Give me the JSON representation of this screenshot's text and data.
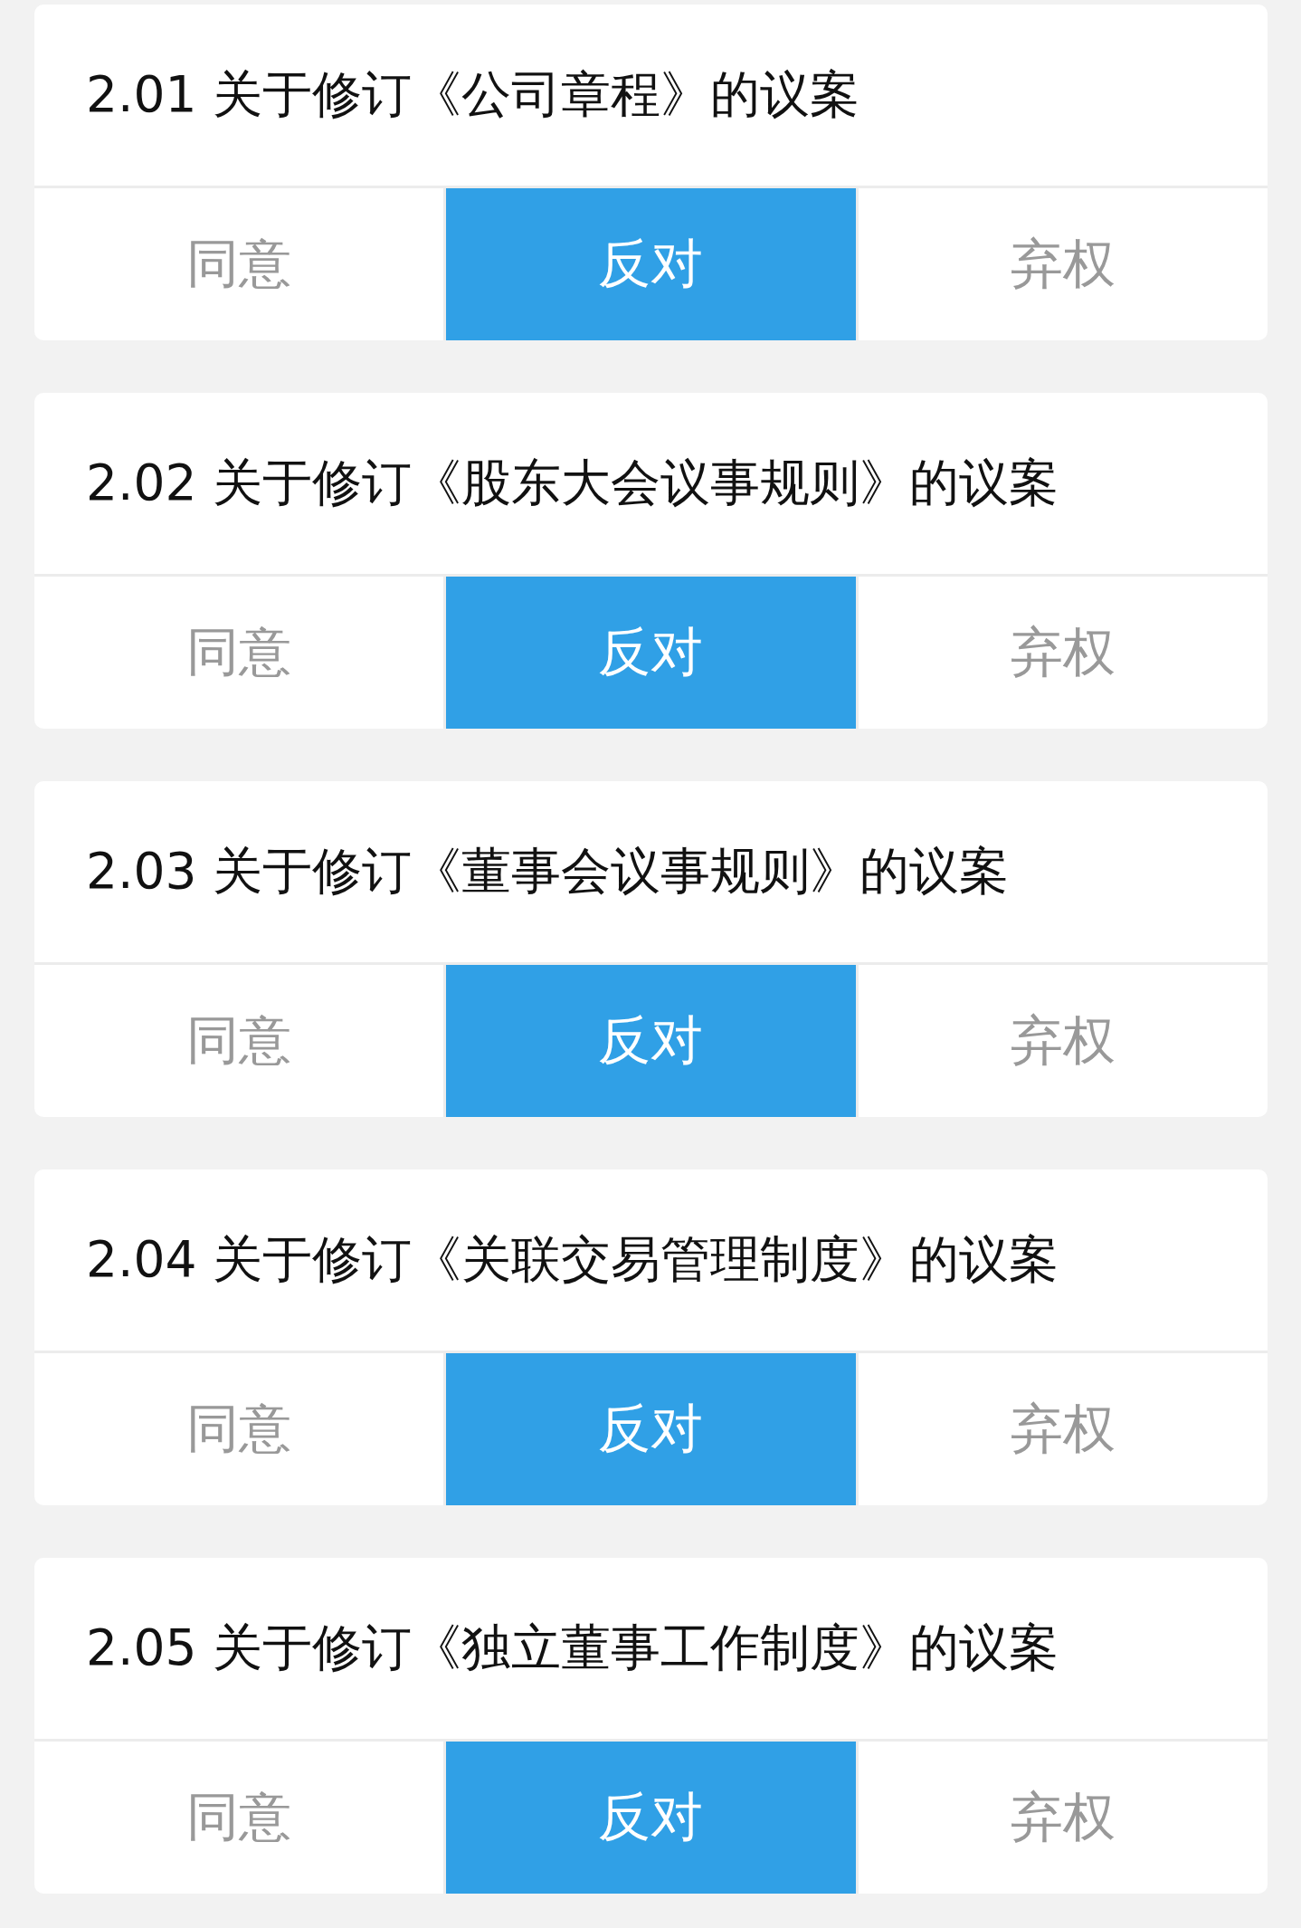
{
  "motions": [
    {
      "title": "2.01 关于修订《公司章程》的议案",
      "options": [
        {
          "label": "同意",
          "selected": false
        },
        {
          "label": "反对",
          "selected": true
        },
        {
          "label": "弃权",
          "selected": false
        }
      ]
    },
    {
      "title": "2.02 关于修订《股东大会议事规则》的议案",
      "options": [
        {
          "label": "同意",
          "selected": false
        },
        {
          "label": "反对",
          "selected": true
        },
        {
          "label": "弃权",
          "selected": false
        }
      ]
    },
    {
      "title": "2.03 关于修订《董事会议事规则》的议案",
      "options": [
        {
          "label": "同意",
          "selected": false
        },
        {
          "label": "反对",
          "selected": true
        },
        {
          "label": "弃权",
          "selected": false
        }
      ]
    },
    {
      "title": "2.04 关于修订《关联交易管理制度》的议案",
      "options": [
        {
          "label": "同意",
          "selected": false
        },
        {
          "label": "反对",
          "selected": true
        },
        {
          "label": "弃权",
          "selected": false
        }
      ]
    },
    {
      "title": "2.05 关于修订《独立董事工作制度》的议案",
      "options": [
        {
          "label": "同意",
          "selected": false
        },
        {
          "label": "反对",
          "selected": true
        },
        {
          "label": "弃权",
          "selected": false
        }
      ]
    }
  ]
}
